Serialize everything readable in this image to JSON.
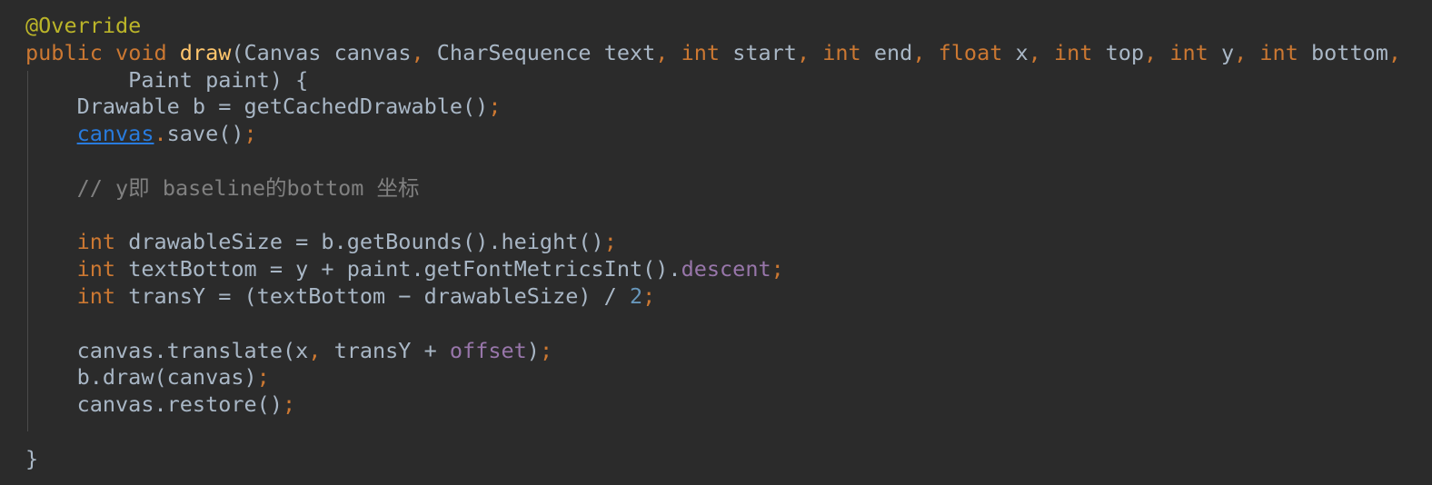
{
  "editor": {
    "background_color": "#2b2b2b",
    "default_text_color": "#a9b7c6",
    "indent_guide_color": "#4b4b4b",
    "language": "Java"
  },
  "palette": {
    "annotation": "#bbb529",
    "keyword": "#cc7832",
    "method_name": "#ffc66d",
    "punctuation": "#cc7832",
    "comment": "#808080",
    "number": "#6897bb",
    "field": "#9876aa",
    "link": "#287bde",
    "plain": "#a9b7c6"
  },
  "code": {
    "lines": [
      {
        "tokens": [
          {
            "text": "@Override",
            "style": "annotation"
          }
        ]
      },
      {
        "tokens": [
          {
            "text": "public",
            "style": "keyword"
          },
          {
            "text": " ",
            "style": "plain"
          },
          {
            "text": "void",
            "style": "keyword"
          },
          {
            "text": " ",
            "style": "plain"
          },
          {
            "text": "draw",
            "style": "method"
          },
          {
            "text": "(Canvas canvas",
            "style": "plain"
          },
          {
            "text": ",",
            "style": "punct"
          },
          {
            "text": " CharSequence text",
            "style": "plain"
          },
          {
            "text": ",",
            "style": "punct"
          },
          {
            "text": " ",
            "style": "plain"
          },
          {
            "text": "int",
            "style": "keyword"
          },
          {
            "text": " start",
            "style": "plain"
          },
          {
            "text": ",",
            "style": "punct"
          },
          {
            "text": " ",
            "style": "plain"
          },
          {
            "text": "int",
            "style": "keyword"
          },
          {
            "text": " end",
            "style": "plain"
          },
          {
            "text": ",",
            "style": "punct"
          },
          {
            "text": " ",
            "style": "plain"
          },
          {
            "text": "float",
            "style": "keyword"
          },
          {
            "text": " x",
            "style": "plain"
          },
          {
            "text": ",",
            "style": "punct"
          },
          {
            "text": " ",
            "style": "plain"
          },
          {
            "text": "int",
            "style": "keyword"
          },
          {
            "text": " top",
            "style": "plain"
          },
          {
            "text": ",",
            "style": "punct"
          },
          {
            "text": " ",
            "style": "plain"
          },
          {
            "text": "int",
            "style": "keyword"
          },
          {
            "text": " y",
            "style": "plain"
          },
          {
            "text": ",",
            "style": "punct"
          },
          {
            "text": " ",
            "style": "plain"
          },
          {
            "text": "int",
            "style": "keyword"
          },
          {
            "text": " bottom",
            "style": "plain"
          },
          {
            "text": ",",
            "style": "punct"
          }
        ]
      },
      {
        "tokens": [
          {
            "text": "        Paint paint) {",
            "style": "plain"
          }
        ]
      },
      {
        "tokens": [
          {
            "text": "    Drawable b = getCachedDrawable()",
            "style": "plain"
          },
          {
            "text": ";",
            "style": "punct"
          }
        ]
      },
      {
        "tokens": [
          {
            "text": "    ",
            "style": "plain"
          },
          {
            "text": "canvas",
            "style": "link"
          },
          {
            "text": ".",
            "style": "punct"
          },
          {
            "text": "save()",
            "style": "plain"
          },
          {
            "text": ";",
            "style": "punct"
          }
        ]
      },
      {
        "tokens": []
      },
      {
        "tokens": [
          {
            "text": "    // y即 baseline的bottom 坐标",
            "style": "comment"
          }
        ]
      },
      {
        "tokens": []
      },
      {
        "tokens": [
          {
            "text": "    ",
            "style": "plain"
          },
          {
            "text": "int",
            "style": "keyword"
          },
          {
            "text": " drawableSize = b.getBounds().height()",
            "style": "plain"
          },
          {
            "text": ";",
            "style": "punct"
          }
        ]
      },
      {
        "tokens": [
          {
            "text": "    ",
            "style": "plain"
          },
          {
            "text": "int",
            "style": "keyword"
          },
          {
            "text": " textBottom = y + paint.getFontMetricsInt().",
            "style": "plain"
          },
          {
            "text": "descent",
            "style": "field"
          },
          {
            "text": ";",
            "style": "punct"
          }
        ]
      },
      {
        "tokens": [
          {
            "text": "    ",
            "style": "plain"
          },
          {
            "text": "int",
            "style": "keyword"
          },
          {
            "text": " transY = (textBottom − drawableSize) / ",
            "style": "plain"
          },
          {
            "text": "2",
            "style": "number"
          },
          {
            "text": ";",
            "style": "punct"
          }
        ]
      },
      {
        "tokens": []
      },
      {
        "tokens": [
          {
            "text": "    canvas.translate(x",
            "style": "plain"
          },
          {
            "text": ",",
            "style": "punct"
          },
          {
            "text": " transY + ",
            "style": "plain"
          },
          {
            "text": "offset",
            "style": "field"
          },
          {
            "text": ")",
            "style": "plain"
          },
          {
            "text": ";",
            "style": "punct"
          }
        ]
      },
      {
        "tokens": [
          {
            "text": "    b.draw(canvas)",
            "style": "plain"
          },
          {
            "text": ";",
            "style": "punct"
          }
        ]
      },
      {
        "tokens": [
          {
            "text": "    canvas.restore()",
            "style": "plain"
          },
          {
            "text": ";",
            "style": "punct"
          }
        ]
      },
      {
        "tokens": []
      },
      {
        "tokens": [
          {
            "text": "}",
            "style": "plain"
          }
        ]
      }
    ]
  }
}
